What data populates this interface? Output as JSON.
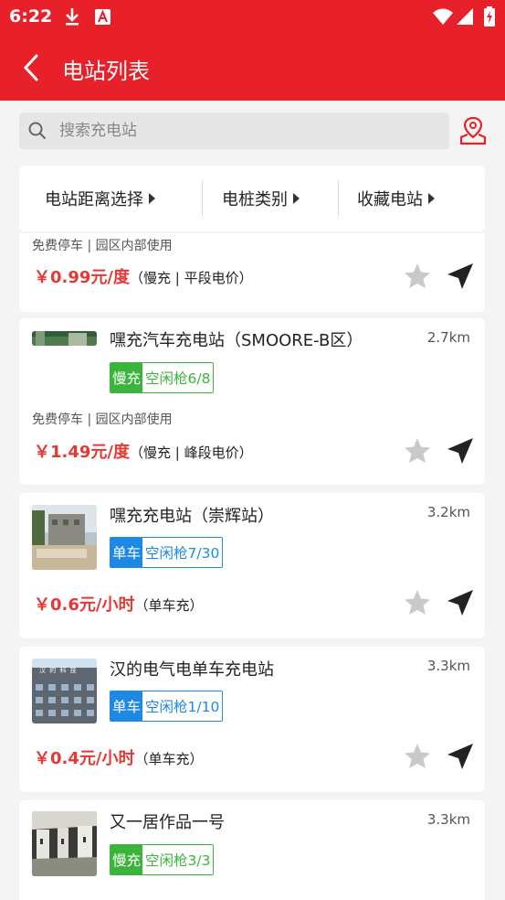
{
  "status_bar": {
    "time": "6:22"
  },
  "header": {
    "title": "电站列表"
  },
  "search": {
    "placeholder": "搜索充电站"
  },
  "filters": [
    {
      "label": "电站距离选择"
    },
    {
      "label": "电桩类别"
    },
    {
      "label": "收藏电站"
    }
  ],
  "colors": {
    "brand": "#e8202a",
    "price": "#e53935",
    "slow_tag": "#3cb43c",
    "bike_tag": "#1e88e5"
  },
  "stations": [
    {
      "name": "",
      "distance": "",
      "tag_type": "",
      "tag_free": "",
      "description": "免费停车 | 园区内部使用",
      "price": "￥0.99元/度",
      "price_note": "（慢充 | 平段电价）"
    },
    {
      "name": "嘿充汽车充电站（SMOORE-B区）",
      "distance": "2.7km",
      "tag_type": "慢充",
      "tag_free": "空闲枪6/8",
      "description": "免费停车 | 园区内部使用",
      "price": "￥1.49元/度",
      "price_note": "（慢充 | 峰段电价）"
    },
    {
      "name": "嘿充充电站（崇辉站）",
      "distance": "3.2km",
      "tag_type": "单车",
      "tag_free": "空闲枪7/30",
      "description": "",
      "price": "￥0.6元/小时",
      "price_note": "（单车充）"
    },
    {
      "name": "汉的电气电单车充电站",
      "distance": "3.3km",
      "tag_type": "单车",
      "tag_free": "空闲枪1/10",
      "description": "",
      "price": "￥0.4元/小时",
      "price_note": "（单车充）"
    },
    {
      "name": "又一居作品一号",
      "distance": "3.3km",
      "tag_type": "慢充",
      "tag_free": "空闲枪3/3",
      "description": "",
      "price": "",
      "price_note": ""
    }
  ],
  "thumb_sign_text": "汉 的 科 技"
}
